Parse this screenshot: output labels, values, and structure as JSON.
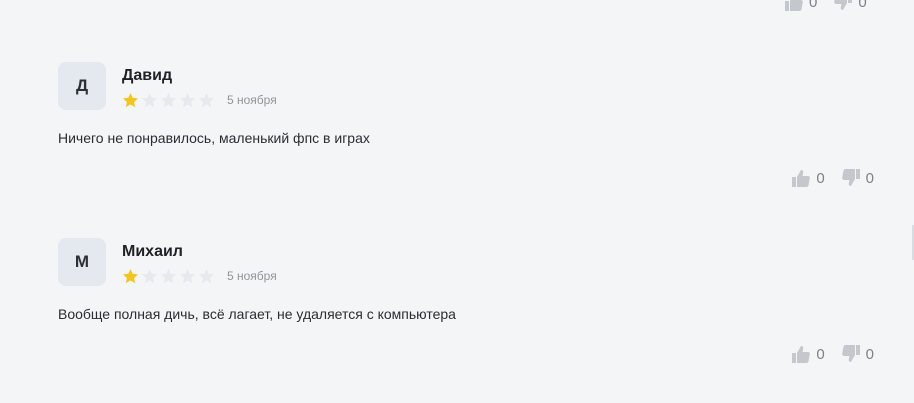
{
  "top_votes": {
    "likes": "0",
    "dislikes": "0"
  },
  "reviews": [
    {
      "initial": "Д",
      "author": "Давид",
      "rating": 1,
      "max_rating": 5,
      "date": "5 ноября",
      "text": "Ничего не понравилось, маленький фпс в играх",
      "likes": "0",
      "dislikes": "0"
    },
    {
      "initial": "М",
      "author": "Михаил",
      "rating": 1,
      "max_rating": 5,
      "date": "5 ноября",
      "text": "Вообще полная дичь, всё лагает, не удаляется с компьютера",
      "likes": "0",
      "dislikes": "0"
    }
  ],
  "colors": {
    "star_filled": "#f5c518",
    "star_empty": "#e6e9ee",
    "thumb": "#c4c8ce"
  }
}
